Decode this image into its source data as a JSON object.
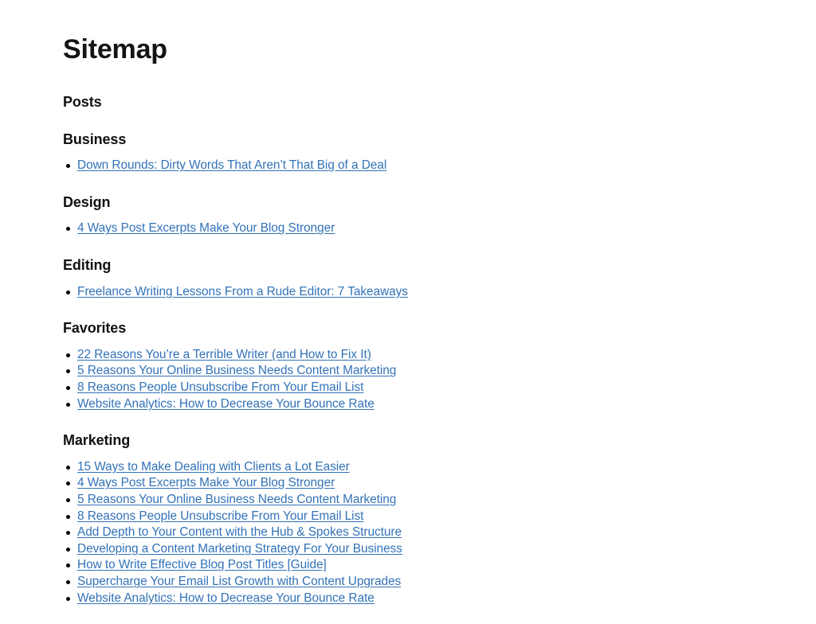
{
  "document": {
    "title": "Sitemap",
    "background_color": "#ffffff",
    "link_color": "#3272b8",
    "heading_color": "#111111"
  },
  "sections": [
    {
      "label": "Posts",
      "categories": [
        {
          "name": "Business",
          "links": [
            "Down Rounds: Dirty Words That Aren’t That Big of a Deal"
          ]
        },
        {
          "name": "Design",
          "links": [
            "4 Ways Post Excerpts Make Your Blog Stronger"
          ]
        },
        {
          "name": "Editing",
          "links": [
            "Freelance Writing Lessons From a Rude Editor: 7 Takeaways"
          ]
        },
        {
          "name": "Favorites",
          "links": [
            "22 Reasons You’re a Terrible Writer (and How to Fix It)",
            "5 Reasons Your Online Business Needs Content Marketing",
            "8 Reasons People Unsubscribe From Your Email List",
            "Website Analytics: How to Decrease Your Bounce Rate"
          ]
        },
        {
          "name": "Marketing",
          "links": [
            "15 Ways to Make Dealing with Clients a Lot Easier",
            "4 Ways Post Excerpts Make Your Blog Stronger",
            "5 Reasons Your Online Business Needs Content Marketing",
            "8 Reasons People Unsubscribe From Your Email List",
            "Add Depth to Your Content with the Hub & Spokes Structure",
            "Developing a Content Marketing Strategy For Your Business",
            "How to Write Effective Blog Post Titles [Guide]",
            "Supercharge Your Email List Growth with Content Upgrades",
            "Website Analytics: How to Decrease Your Bounce Rate"
          ]
        }
      ]
    }
  ]
}
